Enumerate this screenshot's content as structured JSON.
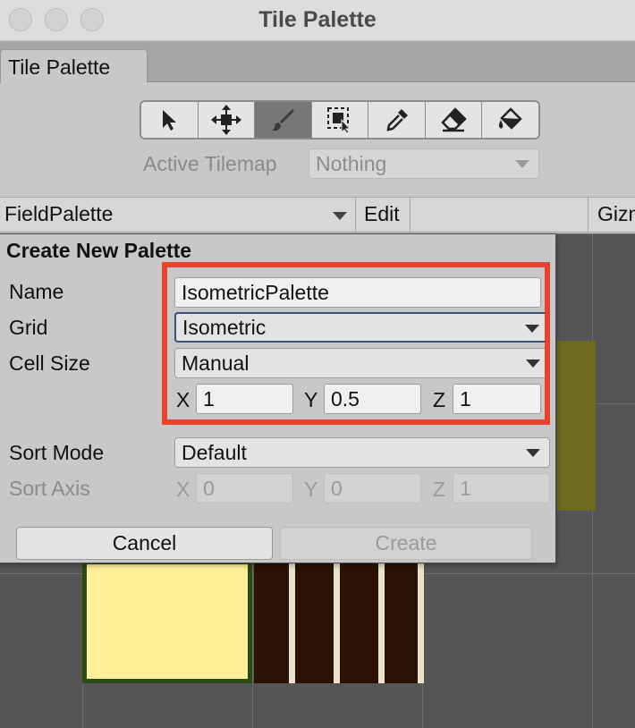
{
  "window": {
    "title": "Tile Palette",
    "traffic_lights": [
      "close",
      "minimize",
      "zoom"
    ]
  },
  "tab": {
    "label": "Tile Palette"
  },
  "toolbar": {
    "tools": [
      {
        "name": "select",
        "icon": "arrow-pointer-icon",
        "active": false
      },
      {
        "name": "move",
        "icon": "move-arrows-icon",
        "active": false
      },
      {
        "name": "paint",
        "icon": "paint-brush-icon",
        "active": true
      },
      {
        "name": "box-fill",
        "icon": "box-fill-icon",
        "active": false
      },
      {
        "name": "pick",
        "icon": "eyedropper-icon",
        "active": false
      },
      {
        "name": "erase",
        "icon": "eraser-icon",
        "active": false
      },
      {
        "name": "fill",
        "icon": "paint-bucket-icon",
        "active": false
      }
    ],
    "active_tilemap_label": "Active Tilemap",
    "active_tilemap_value": "Nothing"
  },
  "palette_header": {
    "palette_name": "FieldPalette",
    "edit_label": "Edit",
    "gizmos_label": "Gizm"
  },
  "dialog": {
    "title": "Create New Palette",
    "name_label": "Name",
    "name_value": "IsometricPalette",
    "grid_label": "Grid",
    "grid_value": "Isometric",
    "cell_size_label": "Cell Size",
    "cell_size_value": "Manual",
    "cell_x_label": "X",
    "cell_x": "1",
    "cell_y_label": "Y",
    "cell_y": "0.5",
    "cell_z_label": "Z",
    "cell_z": "1",
    "sort_mode_label": "Sort Mode",
    "sort_mode_value": "Default",
    "sort_axis_label": "Sort Axis",
    "sort_x_label": "X",
    "sort_x": "0",
    "sort_y_label": "Y",
    "sort_y": "0",
    "sort_z_label": "Z",
    "sort_z": "1",
    "cancel_label": "Cancel",
    "create_label": "Create"
  },
  "colors": {
    "highlight": "#e8412d",
    "grid_background": "#555555",
    "olive_tile": "#6e6a22",
    "yellow_tile": "#fff099",
    "dark_tile": "#2a1204"
  }
}
